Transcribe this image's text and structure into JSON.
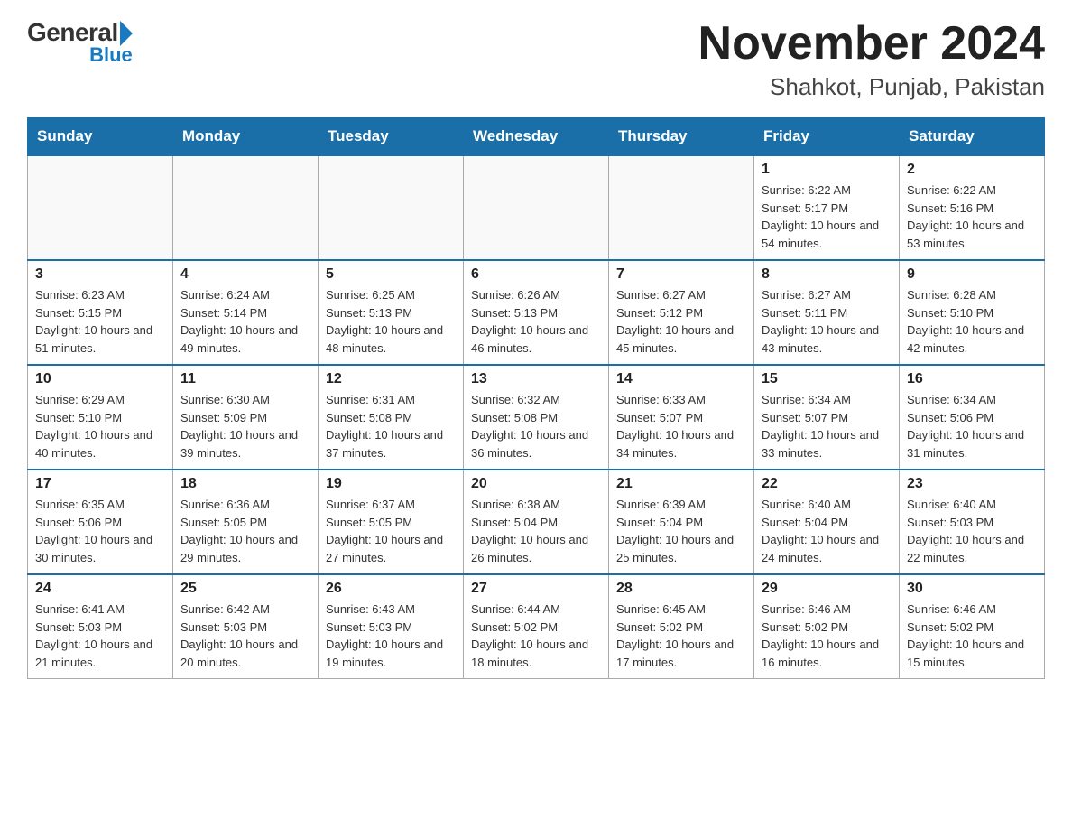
{
  "header": {
    "logo_general": "General",
    "logo_blue": "Blue",
    "main_title": "November 2024",
    "subtitle": "Shahkot, Punjab, Pakistan"
  },
  "days_of_week": [
    "Sunday",
    "Monday",
    "Tuesday",
    "Wednesday",
    "Thursday",
    "Friday",
    "Saturday"
  ],
  "weeks": [
    [
      {
        "day": "",
        "info": ""
      },
      {
        "day": "",
        "info": ""
      },
      {
        "day": "",
        "info": ""
      },
      {
        "day": "",
        "info": ""
      },
      {
        "day": "",
        "info": ""
      },
      {
        "day": "1",
        "info": "Sunrise: 6:22 AM\nSunset: 5:17 PM\nDaylight: 10 hours and 54 minutes."
      },
      {
        "day": "2",
        "info": "Sunrise: 6:22 AM\nSunset: 5:16 PM\nDaylight: 10 hours and 53 minutes."
      }
    ],
    [
      {
        "day": "3",
        "info": "Sunrise: 6:23 AM\nSunset: 5:15 PM\nDaylight: 10 hours and 51 minutes."
      },
      {
        "day": "4",
        "info": "Sunrise: 6:24 AM\nSunset: 5:14 PM\nDaylight: 10 hours and 49 minutes."
      },
      {
        "day": "5",
        "info": "Sunrise: 6:25 AM\nSunset: 5:13 PM\nDaylight: 10 hours and 48 minutes."
      },
      {
        "day": "6",
        "info": "Sunrise: 6:26 AM\nSunset: 5:13 PM\nDaylight: 10 hours and 46 minutes."
      },
      {
        "day": "7",
        "info": "Sunrise: 6:27 AM\nSunset: 5:12 PM\nDaylight: 10 hours and 45 minutes."
      },
      {
        "day": "8",
        "info": "Sunrise: 6:27 AM\nSunset: 5:11 PM\nDaylight: 10 hours and 43 minutes."
      },
      {
        "day": "9",
        "info": "Sunrise: 6:28 AM\nSunset: 5:10 PM\nDaylight: 10 hours and 42 minutes."
      }
    ],
    [
      {
        "day": "10",
        "info": "Sunrise: 6:29 AM\nSunset: 5:10 PM\nDaylight: 10 hours and 40 minutes."
      },
      {
        "day": "11",
        "info": "Sunrise: 6:30 AM\nSunset: 5:09 PM\nDaylight: 10 hours and 39 minutes."
      },
      {
        "day": "12",
        "info": "Sunrise: 6:31 AM\nSunset: 5:08 PM\nDaylight: 10 hours and 37 minutes."
      },
      {
        "day": "13",
        "info": "Sunrise: 6:32 AM\nSunset: 5:08 PM\nDaylight: 10 hours and 36 minutes."
      },
      {
        "day": "14",
        "info": "Sunrise: 6:33 AM\nSunset: 5:07 PM\nDaylight: 10 hours and 34 minutes."
      },
      {
        "day": "15",
        "info": "Sunrise: 6:34 AM\nSunset: 5:07 PM\nDaylight: 10 hours and 33 minutes."
      },
      {
        "day": "16",
        "info": "Sunrise: 6:34 AM\nSunset: 5:06 PM\nDaylight: 10 hours and 31 minutes."
      }
    ],
    [
      {
        "day": "17",
        "info": "Sunrise: 6:35 AM\nSunset: 5:06 PM\nDaylight: 10 hours and 30 minutes."
      },
      {
        "day": "18",
        "info": "Sunrise: 6:36 AM\nSunset: 5:05 PM\nDaylight: 10 hours and 29 minutes."
      },
      {
        "day": "19",
        "info": "Sunrise: 6:37 AM\nSunset: 5:05 PM\nDaylight: 10 hours and 27 minutes."
      },
      {
        "day": "20",
        "info": "Sunrise: 6:38 AM\nSunset: 5:04 PM\nDaylight: 10 hours and 26 minutes."
      },
      {
        "day": "21",
        "info": "Sunrise: 6:39 AM\nSunset: 5:04 PM\nDaylight: 10 hours and 25 minutes."
      },
      {
        "day": "22",
        "info": "Sunrise: 6:40 AM\nSunset: 5:04 PM\nDaylight: 10 hours and 24 minutes."
      },
      {
        "day": "23",
        "info": "Sunrise: 6:40 AM\nSunset: 5:03 PM\nDaylight: 10 hours and 22 minutes."
      }
    ],
    [
      {
        "day": "24",
        "info": "Sunrise: 6:41 AM\nSunset: 5:03 PM\nDaylight: 10 hours and 21 minutes."
      },
      {
        "day": "25",
        "info": "Sunrise: 6:42 AM\nSunset: 5:03 PM\nDaylight: 10 hours and 20 minutes."
      },
      {
        "day": "26",
        "info": "Sunrise: 6:43 AM\nSunset: 5:03 PM\nDaylight: 10 hours and 19 minutes."
      },
      {
        "day": "27",
        "info": "Sunrise: 6:44 AM\nSunset: 5:02 PM\nDaylight: 10 hours and 18 minutes."
      },
      {
        "day": "28",
        "info": "Sunrise: 6:45 AM\nSunset: 5:02 PM\nDaylight: 10 hours and 17 minutes."
      },
      {
        "day": "29",
        "info": "Sunrise: 6:46 AM\nSunset: 5:02 PM\nDaylight: 10 hours and 16 minutes."
      },
      {
        "day": "30",
        "info": "Sunrise: 6:46 AM\nSunset: 5:02 PM\nDaylight: 10 hours and 15 minutes."
      }
    ]
  ]
}
